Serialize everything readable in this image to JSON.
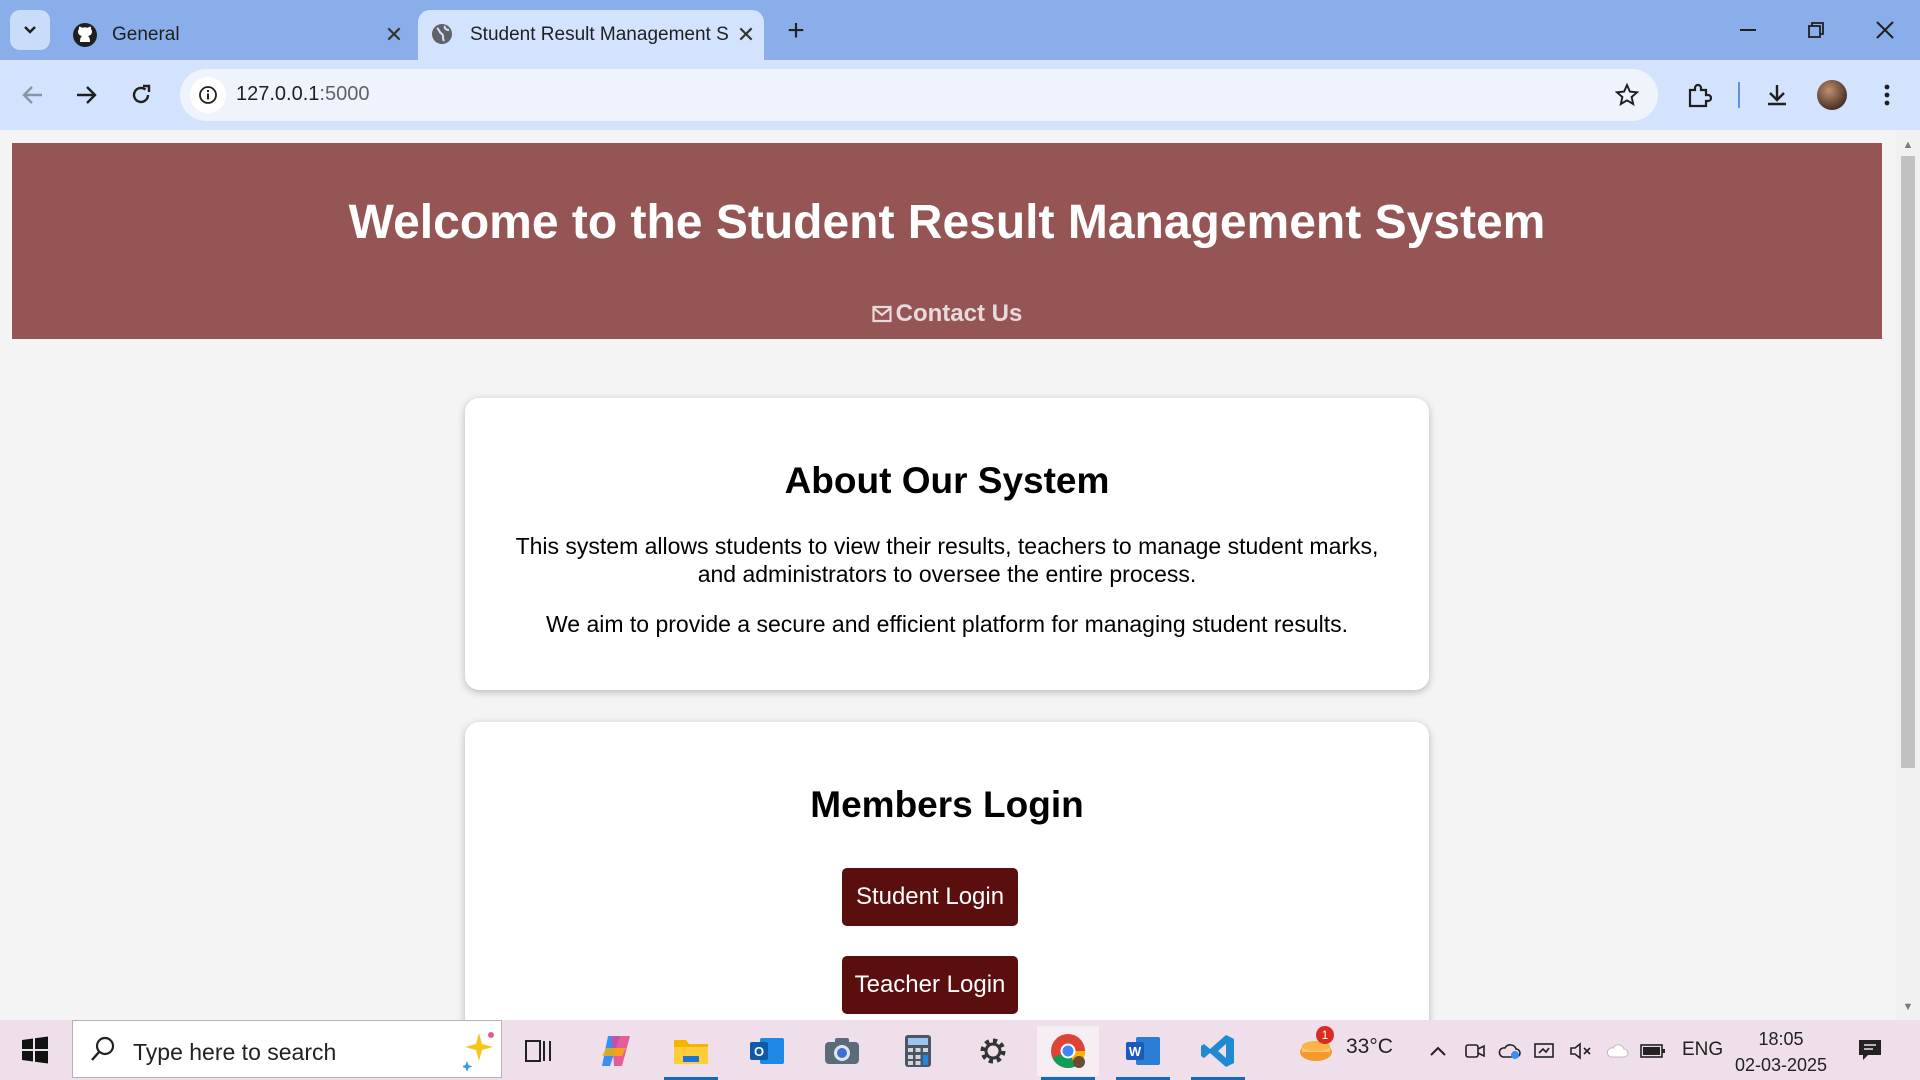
{
  "browser": {
    "tabs": [
      {
        "title": "General",
        "icon": "github-icon"
      },
      {
        "title": "Student Result Management Sy",
        "icon": "globe-icon",
        "active": true
      }
    ],
    "url": {
      "host": "127.0.0.1",
      "port": ":5000"
    }
  },
  "page": {
    "header": {
      "title": "Welcome to the Student Result Management System",
      "contact_label": "Contact Us"
    },
    "about": {
      "title": "About Our System",
      "paragraph1": "This system allows students to view their results, teachers to manage student marks, and administrators to oversee the entire process.",
      "paragraph2": "We aim to provide a secure and efficient platform for managing student results."
    },
    "login": {
      "title": "Members Login",
      "student_button": "Student Login",
      "teacher_button": "Teacher Login"
    }
  },
  "colors": {
    "header_bg": "#955555",
    "button_bg": "#5a0e0e",
    "tabstrip": "#8aaee9",
    "toolbar": "#d3e3fd"
  },
  "taskbar": {
    "search_placeholder": "Type here to search",
    "weather": {
      "temp": "33°C",
      "badge": "1"
    },
    "language": "ENG",
    "time": "18:05",
    "date": "02-03-2025"
  }
}
